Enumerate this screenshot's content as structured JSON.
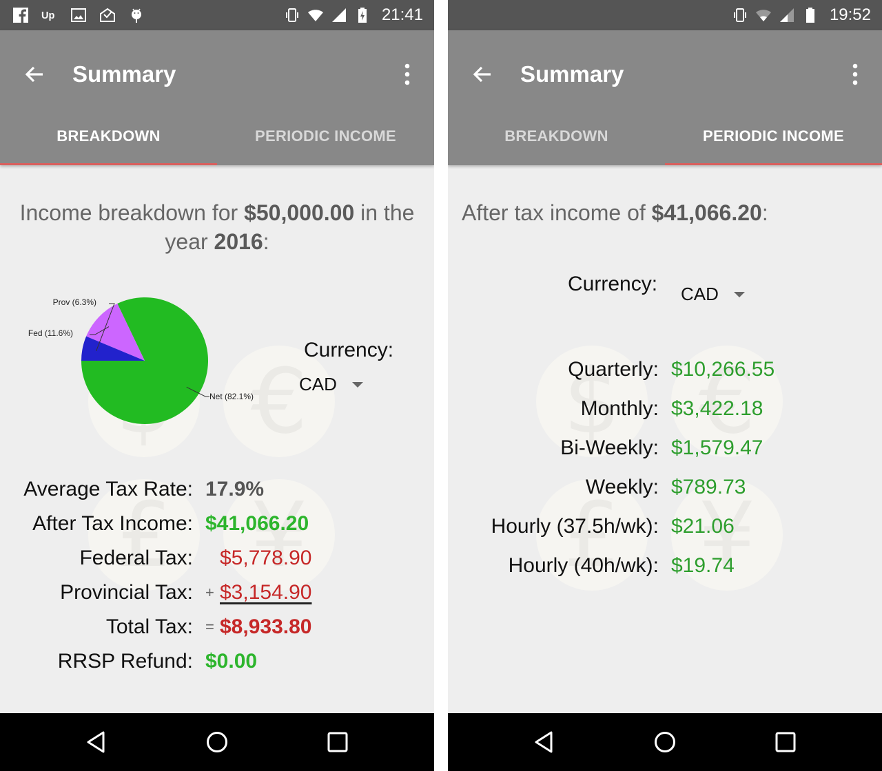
{
  "left_screen": {
    "status_bar": {
      "notification_icons": [
        "facebook-icon",
        "upwork-icon",
        "image-icon",
        "mail-check-icon",
        "android-debug-icon"
      ],
      "system_icons": [
        "vibrate-icon",
        "wifi-icon",
        "cell-signal-icon",
        "battery-charging-icon"
      ],
      "time": "21:41"
    },
    "app_bar": {
      "title": "Summary",
      "back_icon": "arrow-back-icon",
      "menu_icon": "more-vert-icon"
    },
    "tabs": [
      {
        "label": "BREAKDOWN",
        "active": true
      },
      {
        "label": "PERIODIC INCOME",
        "active": false
      }
    ],
    "headline": {
      "prefix": "Income breakdown for ",
      "amount": "$50,000.00",
      "middle": " in the year ",
      "year": "2016",
      "suffix": ":"
    },
    "currency": {
      "label": "Currency:",
      "selected": "CAD"
    },
    "summary_rows": [
      {
        "label": "Average Tax Rate:",
        "value": "17.9%",
        "operator": "",
        "color": "#555555",
        "bold": true,
        "underline": false
      },
      {
        "label": "After Tax Income:",
        "value": "$41,066.20",
        "operator": "",
        "color": "#2db52d",
        "bold": true,
        "underline": false
      },
      {
        "label": "Federal Tax:",
        "value": "$5,778.90",
        "operator": "",
        "color": "#c62828",
        "bold": false,
        "underline": false
      },
      {
        "label": "Provincial Tax:",
        "value": "$3,154.90",
        "operator": "+",
        "color": "#c62828",
        "bold": false,
        "underline": true
      },
      {
        "label": "Total Tax:",
        "value": "$8,933.80",
        "operator": "=",
        "color": "#c62828",
        "bold": true,
        "underline": false
      },
      {
        "label": "RRSP Refund:",
        "value": "$0.00",
        "operator": "",
        "color": "#2db52d",
        "bold": true,
        "underline": false
      }
    ],
    "background_coins": [
      "$",
      "€",
      "£",
      "¥"
    ]
  },
  "right_screen": {
    "status_bar": {
      "system_icons": [
        "vibrate-icon",
        "wifi-icon",
        "cell-signal-icon",
        "battery-full-icon"
      ],
      "time": "19:52"
    },
    "app_bar": {
      "title": "Summary",
      "back_icon": "arrow-back-icon",
      "menu_icon": "more-vert-icon"
    },
    "tabs": [
      {
        "label": "BREAKDOWN",
        "active": false
      },
      {
        "label": "PERIODIC INCOME",
        "active": true
      }
    ],
    "headline": {
      "prefix": "After tax income of ",
      "amount": "$41,066.20",
      "suffix": ":"
    },
    "currency": {
      "label": "Currency:",
      "selected": "CAD"
    },
    "periodic_rows": [
      {
        "label": "Quarterly:",
        "value": "$10,266.55"
      },
      {
        "label": "Monthly:",
        "value": "$3,422.18"
      },
      {
        "label": "Bi-Weekly:",
        "value": "$1,579.47"
      },
      {
        "label": "Weekly:",
        "value": "$789.73"
      },
      {
        "label": "Hourly (37.5h/wk):",
        "value": "$21.06"
      },
      {
        "label": "Hourly (40h/wk):",
        "value": "$19.74"
      }
    ],
    "value_color": "#2e9e2e",
    "background_coins": [
      "$",
      "€",
      "£",
      "¥"
    ]
  },
  "nav_bar": {
    "buttons": [
      "back-triangle-icon",
      "home-circle-icon",
      "recents-square-icon"
    ]
  },
  "colors": {
    "app_bar": "#888888",
    "status_bar": "#555555",
    "tab_indicator": "#d9605e",
    "background": "#eeeeee"
  },
  "chart_data": {
    "type": "pie",
    "title": "",
    "slices": [
      {
        "label": "Net (82.1%)",
        "name": "Net",
        "value": 82.1,
        "color": "#22bb22"
      },
      {
        "label": "Fed (11.6%)",
        "name": "Fed",
        "value": 11.6,
        "color": "#cc66ff"
      },
      {
        "label": "Prov (6.3%)",
        "name": "Prov",
        "value": 6.3,
        "color": "#2222cc"
      }
    ],
    "legend": "none"
  }
}
